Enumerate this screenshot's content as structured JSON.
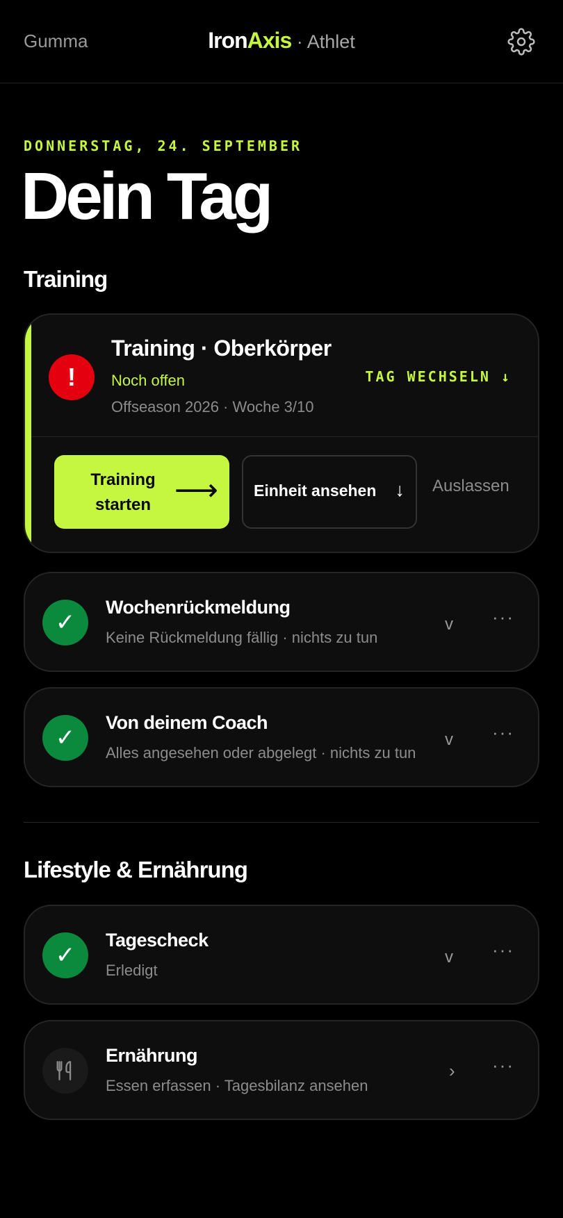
{
  "header": {
    "user_name": "Gumma",
    "brand_iron": "Iron",
    "brand_axis": "Axis",
    "brand_role": " · Athlet",
    "settings_icon": "gear-icon"
  },
  "date_label": "DONNERSTAG, 24. SEPTEMBER",
  "page_title": "Dein Tag",
  "sections": {
    "training": "Training",
    "lifestyle": "Lifestyle & Ernährung"
  },
  "training_card": {
    "title": "Training · Oberkörper",
    "status": "Noch offen",
    "meta": "Offseason 2026 · Woche 3/10",
    "change_day": "TAG WECHSELN ↓",
    "alert_icon_glyph": "!",
    "start_label": "Training starten",
    "start_arrow": "⟶",
    "view_label": "Einheit ansehen",
    "view_arrow": "↓",
    "skip_label": "Auslassen"
  },
  "tasks": [
    {
      "title": "Wochenrückmeldung",
      "subtitle": "Keine Rückmeldung fällig · nichts zu tun",
      "icon": "check-icon",
      "icon_glyph": "✓",
      "chevron": "v",
      "more": "···"
    },
    {
      "title": "Von deinem Coach",
      "subtitle": "Alles angesehen oder abgelegt · nichts zu tun",
      "icon": "check-icon",
      "icon_glyph": "✓",
      "chevron": "v",
      "more": "···"
    },
    {
      "title": "Tagescheck",
      "subtitle": "Erledigt",
      "icon": "check-icon",
      "icon_glyph": "✓",
      "chevron": "v",
      "more": "···"
    },
    {
      "title": "Ernährung",
      "subtitle": "Essen erfassen · Tagesbilanz ansehen",
      "icon": "fork-knife-icon",
      "chevron": "›",
      "more": "···"
    }
  ],
  "colors": {
    "accent": "#c6f740",
    "alert": "#e5000f",
    "success": "#0b8a3e",
    "background": "#000000",
    "card": "#0e0e0e"
  }
}
